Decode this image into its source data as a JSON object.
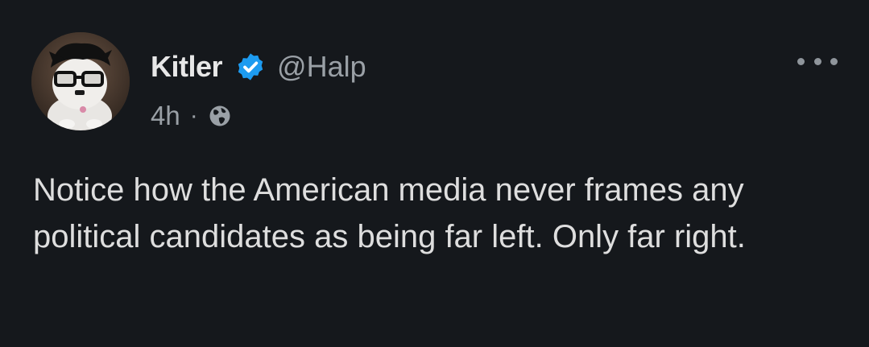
{
  "post": {
    "display_name": "Kitler",
    "handle": "@Halp",
    "verified": true,
    "timestamp": "4h",
    "separator": "·",
    "visibility_icon": "globe-icon",
    "menu_icon": "more-options-icon",
    "text": "Notice how the American media never frames any political candidates as being far left. Only far right."
  },
  "colors": {
    "background": "#15181c",
    "verified_badge": "#1d9bf0",
    "secondary_text": "#9aa0a6"
  }
}
